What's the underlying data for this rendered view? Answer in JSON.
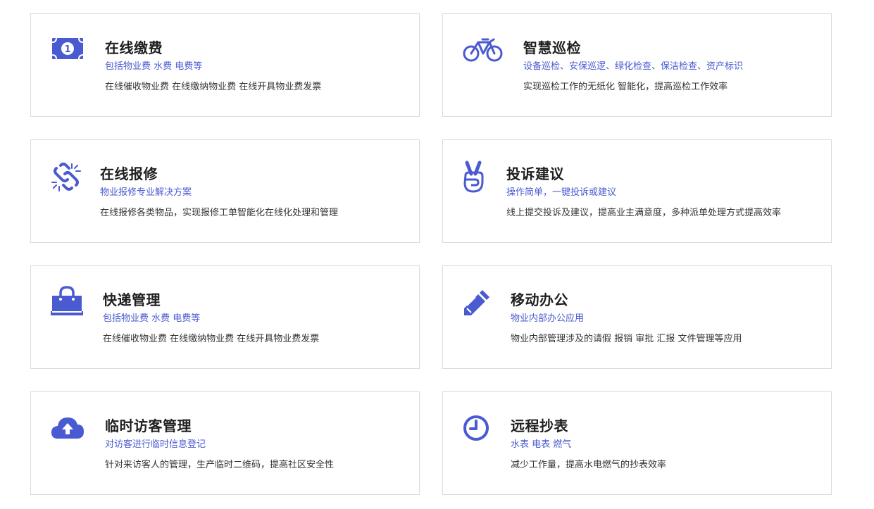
{
  "accent_color": "#4a5ad1",
  "cards": [
    {
      "icon": "money-bill-icon",
      "title": "在线缴费",
      "subtitle": "包括物业费 水费 电费等",
      "desc": "在线催收物业费 在线缴纳物业费 在线开具物业费发票"
    },
    {
      "icon": "bicycle-icon",
      "title": "智慧巡检",
      "subtitle": "设备巡检、安保巡逻、绿化检查、保洁检查、资产标识",
      "desc": "实现巡检工作的无纸化 智能化，提高巡检工作效率"
    },
    {
      "icon": "broken-link-icon",
      "title": "在线报修",
      "subtitle": "物业报修专业解决方案",
      "desc": "在线报修各类物品，实现报修工单智能化在线化处理和管理"
    },
    {
      "icon": "victory-hand-icon",
      "title": "投诉建议",
      "subtitle": "操作简单，一键投诉或建议",
      "desc": "线上提交投诉及建议，提高业主满意度，多种派单处理方式提高效率"
    },
    {
      "icon": "shopping-bag-icon",
      "title": "快递管理",
      "subtitle": "包括物业费 水费 电费等",
      "desc": "在线催收物业费 在线缴纳物业费 在线开具物业费发票"
    },
    {
      "icon": "pencil-icon",
      "title": "移动办公",
      "subtitle": "物业内部办公应用",
      "desc": "物业内部管理涉及的请假 报销 审批 汇报 文件管理等应用"
    },
    {
      "icon": "cloud-upload-icon",
      "title": "临时访客管理",
      "subtitle": "对访客进行临时信息登记",
      "desc": "针对来访客人的管理，生产临时二维码，提高社区安全性"
    },
    {
      "icon": "clock-icon",
      "title": "远程抄表",
      "subtitle": "水表 电表 燃气",
      "desc": "减少工作量，提高水电燃气的抄表效率"
    }
  ]
}
